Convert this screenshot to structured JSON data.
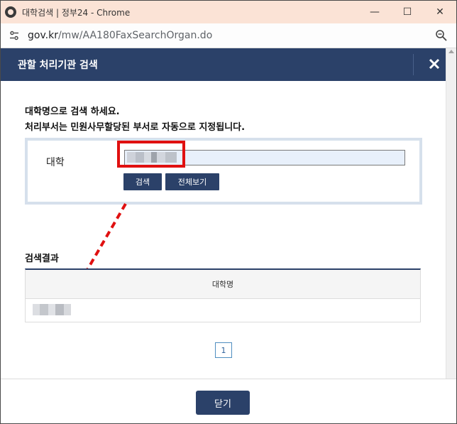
{
  "window": {
    "title": "대학검색 | 정부24 - Chrome",
    "minimize": "—",
    "maximize": "☐",
    "close": "✕"
  },
  "address": {
    "url_host": "gov.kr",
    "url_path": "/mw/AA180FaxSearchOrgan.do"
  },
  "popup": {
    "title": "관할 처리기관 검색",
    "close_symbol": "✕"
  },
  "instructions": {
    "line1": "대학명으로 검색 하세요.",
    "line2": "처리부서는 민원사무할당된 부서로 자동으로 지정됩니다."
  },
  "search": {
    "label": "대학",
    "input_value": "",
    "search_button": "검색",
    "view_all_button": "전체보기"
  },
  "results": {
    "title": "검색결과",
    "column_header": "대학명",
    "page": "1"
  },
  "footer": {
    "close_button": "닫기"
  },
  "colors": {
    "navy": "#2b4169",
    "highlight_red": "#e01010",
    "titlebar": "#fbe3d6"
  }
}
